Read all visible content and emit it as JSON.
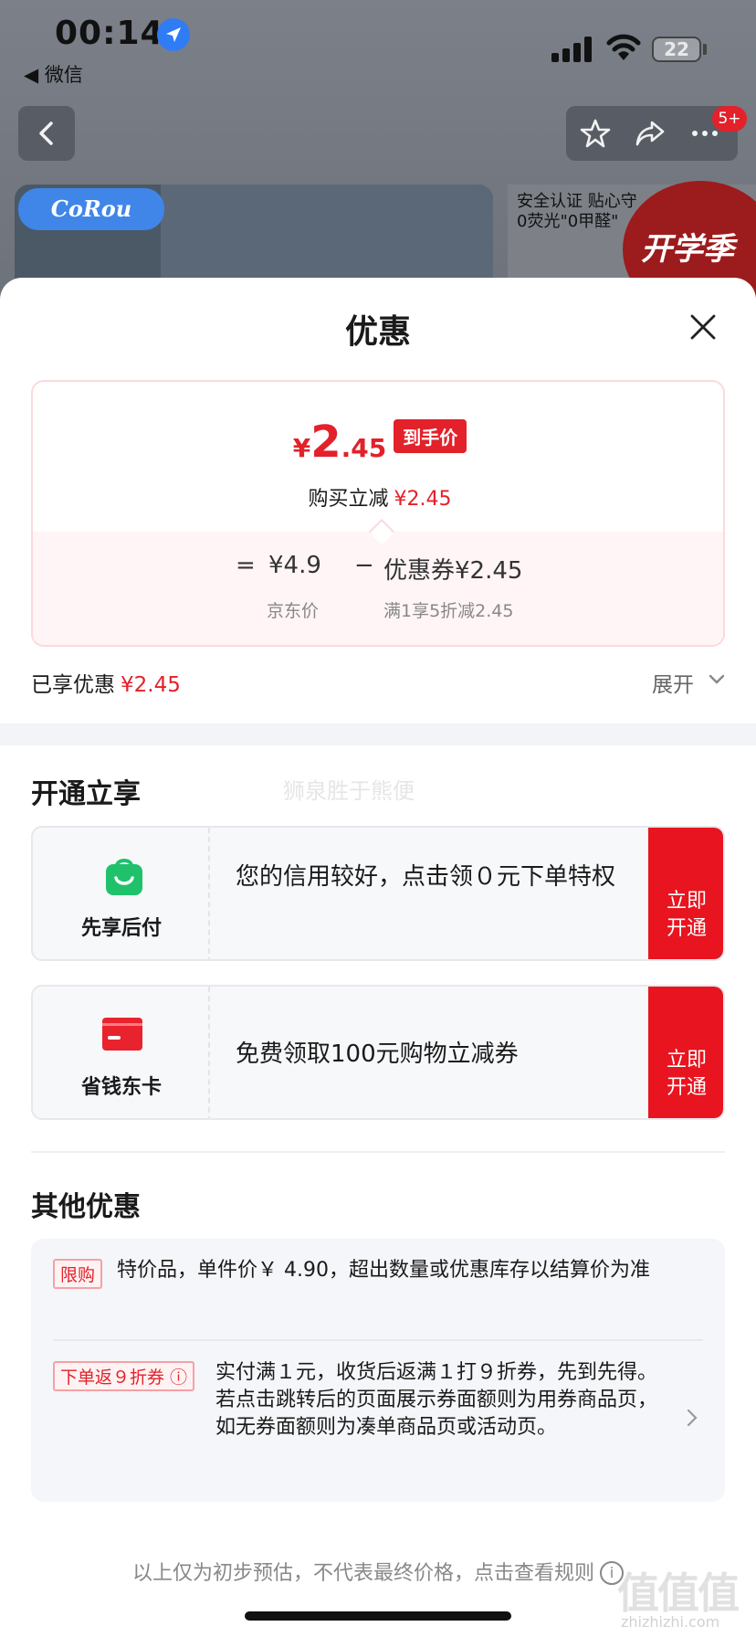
{
  "status_bar": {
    "time": "00:14",
    "back_app": "◀ 微信",
    "battery": "22"
  },
  "nav": {
    "badge": "5+"
  },
  "background": {
    "brand_logo": "CoRou",
    "banner_text_line1": "安全认证 贴心守",
    "banner_text_line2": "0荧光\"0甲醛\"",
    "promo_seal": "开学季"
  },
  "sheet": {
    "title": "优惠",
    "price": {
      "yen": "¥",
      "amount_int": "2",
      "amount_dec": ".45",
      "pill": "到手价",
      "reduce_label": "购买立减",
      "reduce_value": "¥2.45",
      "calc_eq": "=",
      "calc_base": "¥4.9",
      "calc_minus": "−",
      "calc_coupon": "优惠券¥2.45",
      "calc_base_label": "京东价",
      "calc_coupon_label": "满1享5折减2.45"
    },
    "enjoyed_label": "已享优惠",
    "enjoyed_value": "¥2.45",
    "expand_label": "展开",
    "open_section": {
      "title": "开通立享",
      "watermark": "狮泉胜于熊便",
      "cards": [
        {
          "name": "先享后付",
          "desc": "您的信用较好，点击领０元下单特权",
          "cta": "立即\n开通"
        },
        {
          "name": "省钱东卡",
          "desc": "免费领取100元购物立减券",
          "cta": "立即\n开通"
        }
      ]
    },
    "other_section": {
      "title": "其他优惠",
      "items": [
        {
          "tag": "限购",
          "text": "特价品，单件价￥ 4.90，超出数量或优惠库存以结算价为准"
        },
        {
          "tag": "下单返９折券 ⓘ",
          "text": "实付满１元，收货后返满１打９折券，先到先得。若点击跳转后的页面展示券面额则为用券商品页，如无券面额则为凑单商品页或活动页。"
        }
      ]
    },
    "footer": "以上仅为初步预估，不代表最终价格，点击查看规则",
    "footer_info": "i"
  },
  "watermark": {
    "mark": "值值值",
    "url": "zhizhizhi.com"
  },
  "colors": {
    "accent_red": "#e3212a",
    "cta_red": "#e8141f",
    "green_icon": "#1fc26b"
  },
  "icons": {
    "location": "location-arrow-icon",
    "back": "chevron-left-icon",
    "star": "star-icon",
    "share": "share-icon",
    "more": "more-icon",
    "close": "close-icon",
    "expand": "chevron-down-icon",
    "pay_later": "shopping-bag-icon",
    "card": "card-icon",
    "item_chevron": "chevron-right-icon"
  }
}
